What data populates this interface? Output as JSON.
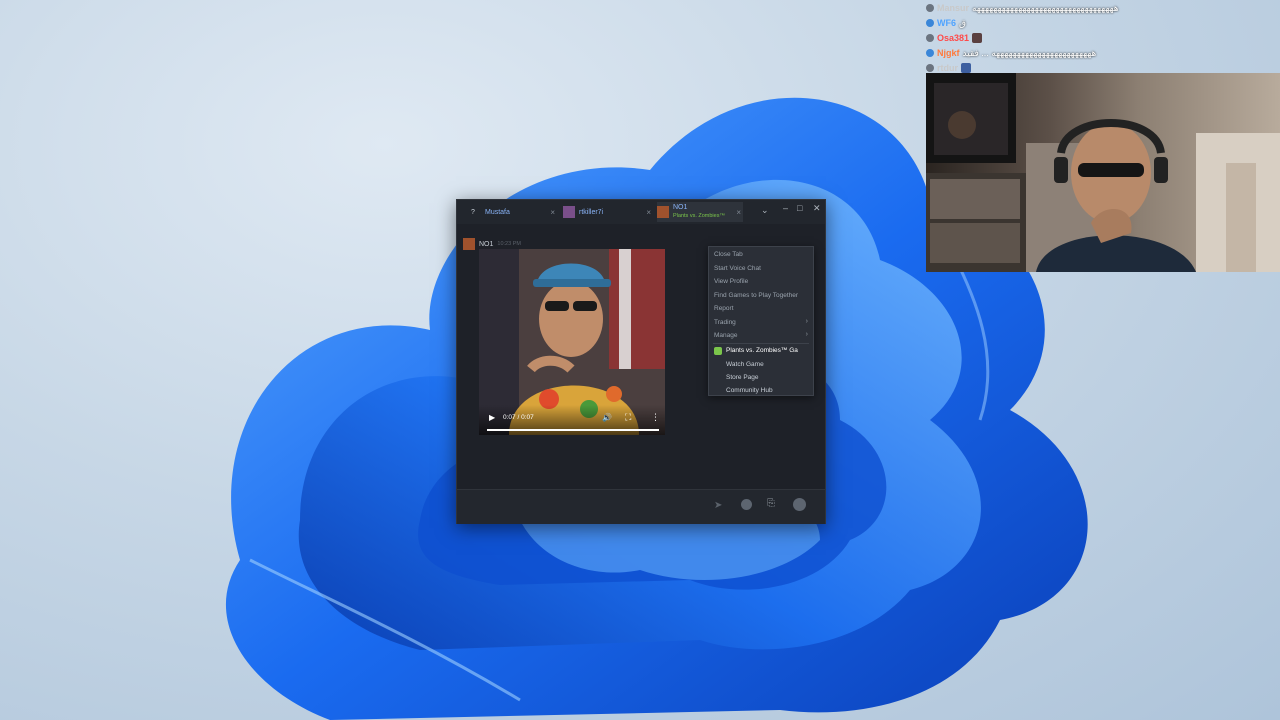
{
  "stream_chat": [
    {
      "user": "Mansur",
      "user_color": "#c9c9c9",
      "message": "ههههههههههههههههههههههههههههههههههه"
    },
    {
      "user": "WF6",
      "user_color": "#4fa3ff",
      "message": "ق"
    },
    {
      "user": "Osa381",
      "user_color": "#ff4a4a",
      "message": ""
    },
    {
      "user": "Njgkf",
      "user_color": "#ff7a3c",
      "message": "ههههههههههههههههههههههههه ... فقيد"
    },
    {
      "user": "rtdur",
      "user_color": "#c9c9c9",
      "message": ""
    }
  ],
  "steam_window": {
    "tabs": [
      {
        "label": "?"
      },
      {
        "label": "Mustafa"
      },
      {
        "label": "rtkiller7i"
      },
      {
        "label": "NO1",
        "sublabel": "Plants vs. Zombies™"
      }
    ],
    "controls": {
      "minimize": "–",
      "maximize": "□",
      "close": "✕",
      "dropdown": "⌄"
    },
    "message": {
      "sender": "NO1",
      "time": "10:23 PM"
    },
    "video": {
      "time": "0:07 / 0:07",
      "progress": 1.0
    },
    "context_menu": {
      "items": [
        {
          "label": "Close Tab"
        },
        {
          "label": "Start Voice Chat"
        },
        {
          "label": "View Profile"
        },
        {
          "label": "Find Games to Play Together"
        },
        {
          "label": "Report"
        },
        {
          "label": "Trading",
          "submenu": true
        },
        {
          "label": "Manage",
          "submenu": true
        }
      ],
      "game_title": "Plants vs. Zombies™ Ga",
      "game_items": [
        {
          "label": "Watch Game"
        },
        {
          "label": "Store Page"
        },
        {
          "label": "Community Hub"
        }
      ]
    }
  },
  "colors": {
    "steam_bg": "#1b1e24",
    "steam_accent": "#8ab4f8",
    "game_green": "#7bc64b",
    "wallpaper_blue": "#1565e6"
  }
}
